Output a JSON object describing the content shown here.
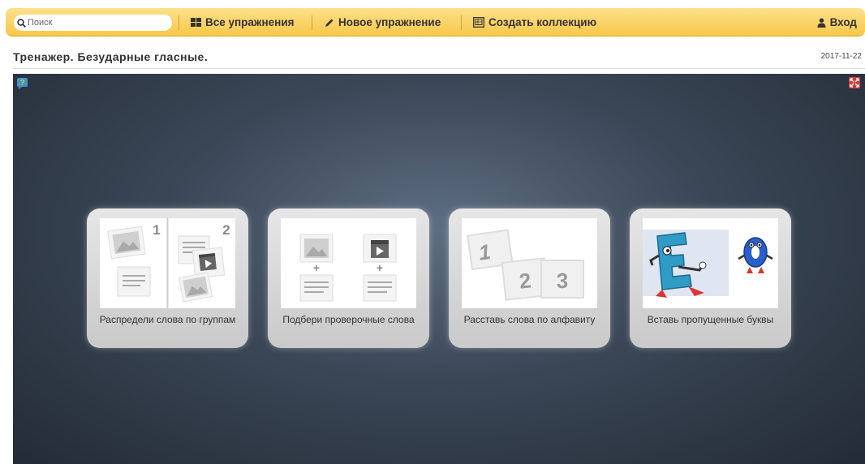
{
  "toolbar": {
    "search_placeholder": "Поиск",
    "all_exercises": "Все упражнения",
    "new_exercise": "Новое упражнение",
    "create_collection": "Создать коллекцию",
    "login": "Вход"
  },
  "page": {
    "title": "Тренажер. Безударные гласные.",
    "date": "2017-11-22"
  },
  "cards": [
    {
      "label": "Распредели слова по группам",
      "thumb_numbers": [
        "1",
        "2"
      ]
    },
    {
      "label": "Подбери проверочные слова"
    },
    {
      "label": "Расставь слова по алфавиту",
      "thumb_numbers": [
        "1",
        "2",
        "3"
      ]
    },
    {
      "label": "Вставь пропущенные буквы"
    }
  ],
  "colors": {
    "toolbar_accent": "#f7c84a",
    "stage_bg": "#3b4757"
  }
}
